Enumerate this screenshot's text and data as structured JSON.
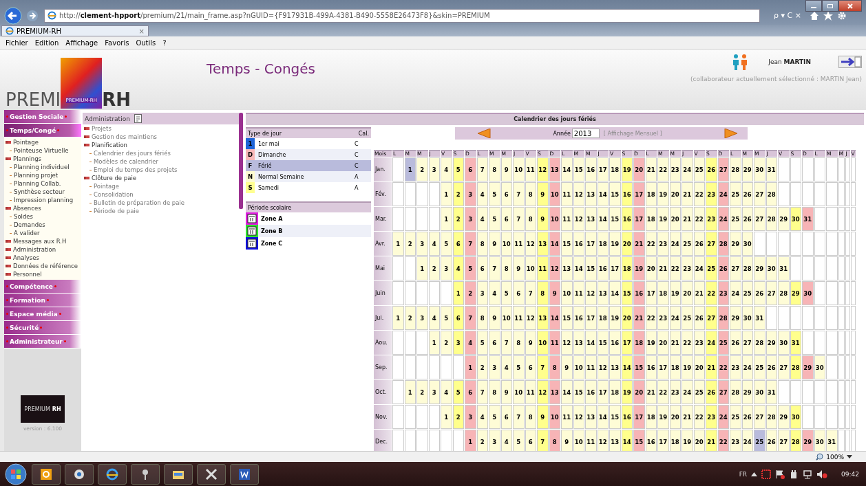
{
  "browser": {
    "url_prefix": "http://",
    "url_host": "clement-hpport",
    "url_rest": "/premium/21/main_frame.asp?nGUID={F917931B-499A-4381-B490-5558E26473F8}&skin=PREMIUM",
    "search_controls": "ρ ▾ C ×",
    "tab": {
      "title": "PREMIUM-RH",
      "close": "×"
    },
    "menu": [
      "Fichier",
      "Edition",
      "Affichage",
      "Favoris",
      "Outils",
      "?"
    ]
  },
  "header": {
    "logo_left": "PREMI",
    "logo_small": "PREMIUM-RH",
    "logo_right": "RH",
    "title": "Temps - Congés",
    "user": "Jean **MARTIN**",
    "selected_note": "(collaborateur actuellement sélectionné : MARTIN Jean)"
  },
  "sidebar": {
    "sections": [
      {
        "label": "Gestion Sociale",
        "expanded": false
      },
      {
        "label": "Temps/Congé",
        "expanded": true,
        "items": [
          {
            "label": "Pointage",
            "children": [
              {
                "label": "Pointeuse Virtuelle"
              }
            ]
          },
          {
            "label": "Plannings",
            "children": [
              {
                "label": "Planning individuel"
              },
              {
                "label": "Planning projet"
              },
              {
                "label": "Planning Collab."
              },
              {
                "label": "Synthèse secteur"
              },
              {
                "label": "Impression planning"
              }
            ]
          },
          {
            "label": "Absences",
            "children": [
              {
                "label": "Soldes"
              },
              {
                "label": "Demandes"
              },
              {
                "label": "A valider"
              }
            ]
          },
          {
            "label": "Messages aux R.H"
          },
          {
            "label": "Administration"
          },
          {
            "label": "Analyses"
          },
          {
            "label": "Données de référence"
          },
          {
            "label": "Personnel"
          }
        ]
      },
      {
        "label": "Compétence",
        "expanded": false
      },
      {
        "label": "Formation",
        "expanded": false
      },
      {
        "label": "Espace média",
        "expanded": false
      },
      {
        "label": "Sécurité",
        "expanded": false
      },
      {
        "label": "Administrateur",
        "expanded": false
      }
    ],
    "logo_left": "PREMIUM",
    "logo_right": "RH",
    "version": "version : 6.100"
  },
  "subpanel": {
    "title": "Administration",
    "items": [
      {
        "label": "Projets"
      },
      {
        "label": "Gestion des maintiens"
      },
      {
        "label": "Planification",
        "children": [
          {
            "label": "Calendrier des jours fériés"
          },
          {
            "label": "Modèles de calendrier"
          },
          {
            "label": "Emploi du temps des projets"
          }
        ]
      },
      {
        "label": "Clôture de paie",
        "children": [
          {
            "label": "Pointage"
          },
          {
            "label": "Consolidation"
          },
          {
            "label": "Bulletin de préparation de paie"
          },
          {
            "label": "Période de paie"
          }
        ]
      }
    ]
  },
  "calendar": {
    "title": "Calendrier des jours fériés",
    "day_types": {
      "heading": "Type de jour",
      "cal_heading": "Cal.",
      "items": [
        {
          "code": "1",
          "label": "1er mai",
          "cal": "C",
          "color": "#1e64d8",
          "selected": false
        },
        {
          "code": "D",
          "label": "Dimanche",
          "cal": "C",
          "color": "#f7b8b8",
          "selected": false
        },
        {
          "code": "F",
          "label": "Férié",
          "cal": "C",
          "color": "#b9bbdc",
          "selected": true
        },
        {
          "code": "N",
          "label": "Normal Semaine",
          "cal": "A",
          "color": "#fdfbd0",
          "selected": false
        },
        {
          "code": "S",
          "label": "Samedi",
          "cal": "A",
          "color": "#ffff90",
          "selected": false
        }
      ]
    },
    "school": {
      "heading": "Période scolaire",
      "zones": [
        {
          "label": "Zone A",
          "color": "#e020e0"
        },
        {
          "label": "Zone B",
          "color": "#30e030"
        },
        {
          "label": "Zone C",
          "color": "#1010e0"
        }
      ]
    },
    "year_label": "Année",
    "year": "2013",
    "view_link": "[ Affichage Mensuel ]",
    "month_heading": "Mois",
    "weekdays": [
      {
        "label": "L",
        "kind": "weekday"
      },
      {
        "label": "M",
        "kind": "weekday"
      },
      {
        "label": "M",
        "kind": "weekday"
      },
      {
        "label": "J",
        "kind": "weekday"
      },
      {
        "label": "V",
        "kind": "weekday"
      },
      {
        "label": "S",
        "kind": "saturday"
      },
      {
        "label": "D",
        "kind": "sunday"
      },
      {
        "label": "L",
        "kind": "weekday"
      },
      {
        "label": "M",
        "kind": "weekday"
      },
      {
        "label": "M",
        "kind": "weekday"
      },
      {
        "label": "J",
        "kind": "weekday"
      },
      {
        "label": "V",
        "kind": "weekday"
      },
      {
        "label": "S",
        "kind": "saturday"
      },
      {
        "label": "D",
        "kind": "sunday"
      },
      {
        "label": "L",
        "kind": "weekday"
      },
      {
        "label": "M",
        "kind": "weekday"
      },
      {
        "label": "M",
        "kind": "weekday"
      },
      {
        "label": "J",
        "kind": "weekday"
      },
      {
        "label": "V",
        "kind": "weekday"
      },
      {
        "label": "S",
        "kind": "saturday"
      },
      {
        "label": "D",
        "kind": "sunday"
      },
      {
        "label": "L",
        "kind": "weekday"
      },
      {
        "label": "M",
        "kind": "weekday"
      },
      {
        "label": "M",
        "kind": "weekday"
      },
      {
        "label": "J",
        "kind": "weekday"
      },
      {
        "label": "V",
        "kind": "weekday"
      },
      {
        "label": "S",
        "kind": "saturday"
      },
      {
        "label": "D",
        "kind": "sunday"
      },
      {
        "label": "L",
        "kind": "weekday"
      },
      {
        "label": "M",
        "kind": "weekday"
      },
      {
        "label": "M",
        "kind": "weekday"
      },
      {
        "label": "J",
        "kind": "weekday"
      },
      {
        "label": "V",
        "kind": "weekday"
      },
      {
        "label": "S",
        "kind": "saturday"
      },
      {
        "label": "D",
        "kind": "sunday"
      },
      {
        "label": "L",
        "kind": "weekday"
      },
      {
        "label": "M",
        "kind": "weekday"
      },
      {
        "label": "M"
      },
      {
        "label": "J"
      },
      {
        "label": "V"
      }
    ],
    "months": [
      {
        "label": "Jan.",
        "days": [
          {
            "kind": "empty"
          },
          {
            "label": "1",
            "kind": "holiday"
          },
          "2",
          "3",
          "4",
          "5",
          "6",
          "7",
          "8",
          "9",
          "10",
          "11",
          "12",
          "13",
          "14",
          "15",
          "16",
          "17",
          "18",
          "19",
          "20",
          "21",
          "22",
          "23",
          "24",
          "25",
          "26",
          "27",
          "28",
          "29",
          "30",
          "31"
        ]
      },
      {
        "label": "Fév.",
        "days": [
          {
            "kind": "empty"
          },
          {
            "kind": "empty"
          },
          {
            "kind": "empty"
          },
          {
            "kind": "empty"
          },
          "1",
          "2",
          "3",
          "4",
          "5",
          "6",
          "7",
          "8",
          "9",
          "10",
          "11",
          "12",
          "13",
          "14",
          "15",
          "16",
          "17",
          "18",
          "19",
          "20",
          "21",
          "22",
          "23",
          "24",
          "25",
          "26",
          "27",
          "28"
        ]
      },
      {
        "label": "Mar.",
        "days": [
          {
            "kind": "empty"
          },
          {
            "kind": "empty"
          },
          {
            "kind": "empty"
          },
          {
            "kind": "empty"
          },
          "1",
          "2",
          "3",
          "4",
          "5",
          "6",
          "7",
          "8",
          "9",
          "10",
          "11",
          "12",
          "13",
          "14",
          "15",
          "16",
          "17",
          "18",
          "19",
          "20",
          "21",
          "22",
          "23",
          "24",
          "25",
          "26",
          "27",
          "28",
          "29",
          "30",
          "31"
        ]
      },
      {
        "label": "Avr.",
        "days": [
          "1",
          "2",
          "3",
          "4",
          "5",
          "6",
          "7",
          "8",
          "9",
          "10",
          "11",
          "12",
          "13",
          "14",
          "15",
          "16",
          "17",
          "18",
          "19",
          "20",
          "21",
          "22",
          "23",
          "24",
          "25",
          "26",
          "27",
          "28",
          "29",
          "30"
        ]
      },
      {
        "label": "Mai",
        "days": [
          {
            "kind": "empty"
          },
          {
            "kind": "empty"
          },
          "1",
          "2",
          "3",
          "4",
          "5",
          "6",
          "7",
          "8",
          "9",
          "10",
          "11",
          "12",
          "13",
          "14",
          "15",
          "16",
          "17",
          "18",
          "19",
          "20",
          "21",
          "22",
          "23",
          "24",
          "25",
          "26",
          "27",
          "28",
          "29",
          "30",
          "31"
        ]
      },
      {
        "label": "Juin",
        "days": [
          {
            "kind": "empty"
          },
          {
            "kind": "empty"
          },
          {
            "kind": "empty"
          },
          {
            "kind": "empty"
          },
          {
            "kind": "empty"
          },
          "1",
          "2",
          "3",
          "4",
          "5",
          "6",
          "7",
          "8",
          "9",
          "10",
          "11",
          "12",
          "13",
          "14",
          "15",
          "16",
          "17",
          "18",
          "19",
          "20",
          "21",
          "22",
          "23",
          "24",
          "25",
          "26",
          "27",
          "28",
          "29",
          "30"
        ]
      },
      {
        "label": "Jui.",
        "days": [
          "1",
          "2",
          "3",
          "4",
          "5",
          "6",
          "7",
          "8",
          "9",
          "10",
          "11",
          "12",
          "13",
          "14",
          "15",
          "16",
          "17",
          "18",
          "19",
          "20",
          "21",
          "22",
          "23",
          "24",
          "25",
          "26",
          "27",
          "28",
          "29",
          "30",
          "31"
        ]
      },
      {
        "label": "Aou.",
        "days": [
          {
            "kind": "empty"
          },
          {
            "kind": "empty"
          },
          {
            "kind": "empty"
          },
          "1",
          "2",
          "3",
          "4",
          "5",
          "6",
          "7",
          "8",
          "9",
          "10",
          "11",
          "12",
          "13",
          "14",
          "15",
          "16",
          "17",
          "18",
          "19",
          "20",
          "21",
          "22",
          "23",
          "24",
          "25",
          "26",
          "27",
          "28",
          "29",
          "30",
          "31"
        ]
      },
      {
        "label": "Sep.",
        "days": [
          {
            "kind": "empty"
          },
          {
            "kind": "empty"
          },
          {
            "kind": "empty"
          },
          {
            "kind": "empty"
          },
          {
            "kind": "empty"
          },
          {
            "kind": "empty"
          },
          "1",
          "2",
          "3",
          "4",
          "5",
          "6",
          "7",
          "8",
          "9",
          "10",
          "11",
          "12",
          "13",
          "14",
          "15",
          "16",
          "17",
          "18",
          "19",
          "20",
          "21",
          "22",
          "23",
          "24",
          "25",
          "26",
          "27",
          "28",
          "29",
          "30"
        ]
      },
      {
        "label": "Oct.",
        "days": [
          {
            "kind": "empty"
          },
          "1",
          "2",
          "3",
          "4",
          "5",
          "6",
          "7",
          "8",
          "9",
          "10",
          "11",
          "12",
          "13",
          "14",
          "15",
          "16",
          "17",
          "18",
          "19",
          "20",
          "21",
          "22",
          "23",
          "24",
          "25",
          "26",
          "27",
          "28",
          "29",
          "30",
          "31"
        ]
      },
      {
        "label": "Nov.",
        "days": [
          {
            "kind": "empty"
          },
          {
            "kind": "empty"
          },
          {
            "kind": "empty"
          },
          {
            "kind": "empty"
          },
          "1",
          "2",
          "3",
          "4",
          "5",
          "6",
          "7",
          "8",
          "9",
          "10",
          "11",
          "12",
          "13",
          "14",
          "15",
          "16",
          "17",
          "18",
          "19",
          "20",
          "21",
          "22",
          "23",
          "24",
          "25",
          "26",
          "27",
          "28",
          "29",
          "30"
        ]
      },
      {
        "label": "Dec.",
        "days": [
          {
            "kind": "empty"
          },
          {
            "kind": "empty"
          },
          {
            "kind": "empty"
          },
          {
            "kind": "empty"
          },
          {
            "kind": "empty"
          },
          {
            "kind": "empty"
          },
          "1",
          "2",
          "3",
          "4",
          "5",
          "6",
          "7",
          "8",
          "9",
          "10",
          "11",
          "12",
          "13",
          "14",
          "15",
          "16",
          "17",
          "18",
          "19",
          "20",
          "21",
          "22",
          "23",
          "24",
          {
            "label": "25",
            "kind": "holiday"
          },
          "26",
          "27",
          "28",
          "29",
          "30",
          "31"
        ]
      }
    ]
  },
  "status_bar": {
    "zoom": "100%"
  },
  "taskbar": {
    "language": "FR",
    "clock": "09:42"
  }
}
